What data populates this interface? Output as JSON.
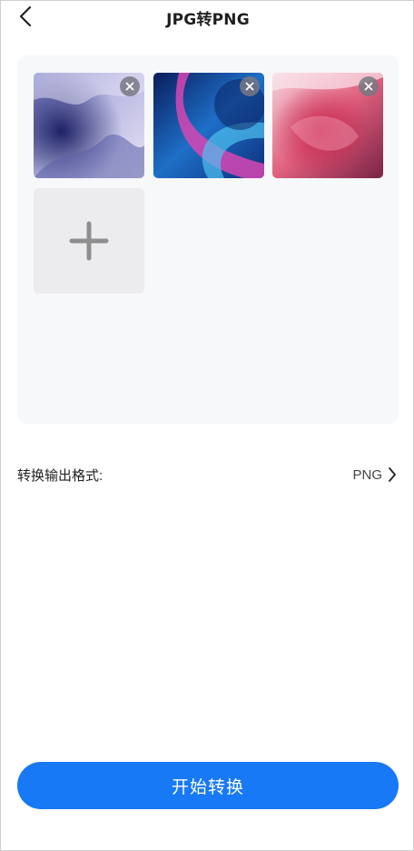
{
  "header": {
    "title": "JPG转PNG",
    "back_icon": "chevron-left-icon"
  },
  "images": {
    "items": [
      {
        "name": "purple-clouds-image",
        "colors": [
          "#3b3f8c",
          "#9aa0d8",
          "#d8d6ee"
        ]
      },
      {
        "name": "blue-abstract-image",
        "colors": [
          "#0b2a7a",
          "#2a86d6",
          "#d64ab0"
        ]
      },
      {
        "name": "pink-clouds-image",
        "colors": [
          "#f3c6d6",
          "#d8466d",
          "#6b1e3c"
        ]
      }
    ],
    "remove_icon": "close-icon",
    "add_icon": "plus-icon"
  },
  "format": {
    "label": "转换输出格式:",
    "value": "PNG",
    "icon": "chevron-right-icon"
  },
  "actions": {
    "start_label": "开始转换"
  },
  "theme": {
    "accent": "#1779f5",
    "panel_bg": "#f7f8fa",
    "add_tile_bg": "#ececee"
  }
}
